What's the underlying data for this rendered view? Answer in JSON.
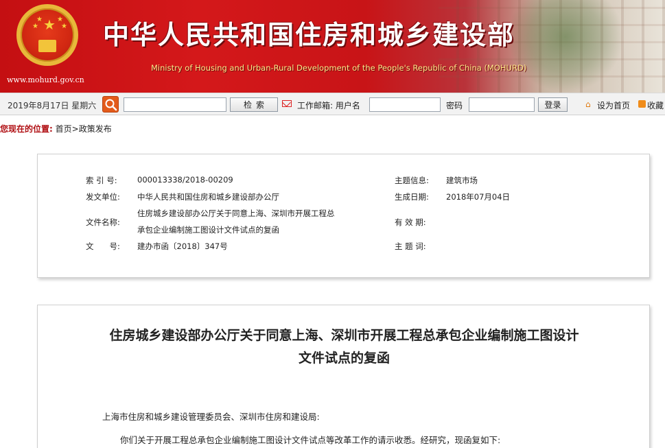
{
  "header": {
    "title": "中华人民共和国住房和城乡建设部",
    "subtitle": "Ministry of Housing and Urban-Rural Development of the People's Republic of China (MOHURD)",
    "url": "www.mohurd.gov.cn"
  },
  "toolbar": {
    "date": "2019年8月17日 星期六",
    "search_value": "",
    "search_button": "检索",
    "mail_label": "工作邮箱: 用户名",
    "username_value": "",
    "password_label": "密码",
    "password_value": "",
    "login_button": "登录",
    "set_home": "设为首页",
    "favorite": "收藏"
  },
  "breadcrumb": {
    "label": "您现在的位置:",
    "home": "首页",
    "separator": ">",
    "current": "政策发布"
  },
  "meta": {
    "index_label": "索 引 号:",
    "index_value": "000013338/2018-00209",
    "issuer_label": "发文单位:",
    "issuer_value": "中华人民共和国住房和城乡建设部办公厅",
    "filename_label": "文件名称:",
    "filename_line1": "住房城乡建设部办公厅关于同意上海、深圳市开展工程总",
    "filename_line2": "承包企业编制施工图设计文件试点的复函",
    "docno_label": "文　　号:",
    "docno_value": "建办市函〔2018〕347号",
    "topic_label": "主题信息:",
    "topic_value": "建筑市场",
    "date_label": "生成日期:",
    "date_value": "2018年07月04日",
    "validity_label": "有 效 期:",
    "validity_value": "",
    "keywords_label": "主 题 词:",
    "keywords_value": ""
  },
  "document": {
    "title_line1": "住房城乡建设部办公厅关于同意上海、深圳市开展工程总承包企业编制施工图设计",
    "title_line2": "文件试点的复函",
    "salutation": "上海市住房和城乡建设管理委员会、深圳市住房和建设局:",
    "paragraph1": "你们关于开展工程总承包企业编制施工图设计文件试点等改革工作的请示收悉。经研究，现函复如下:"
  },
  "colors": {
    "banner_red": "#c40f12",
    "breadcrumb_label": "#b00f13",
    "search_icon_bg": "#e35b1b"
  }
}
